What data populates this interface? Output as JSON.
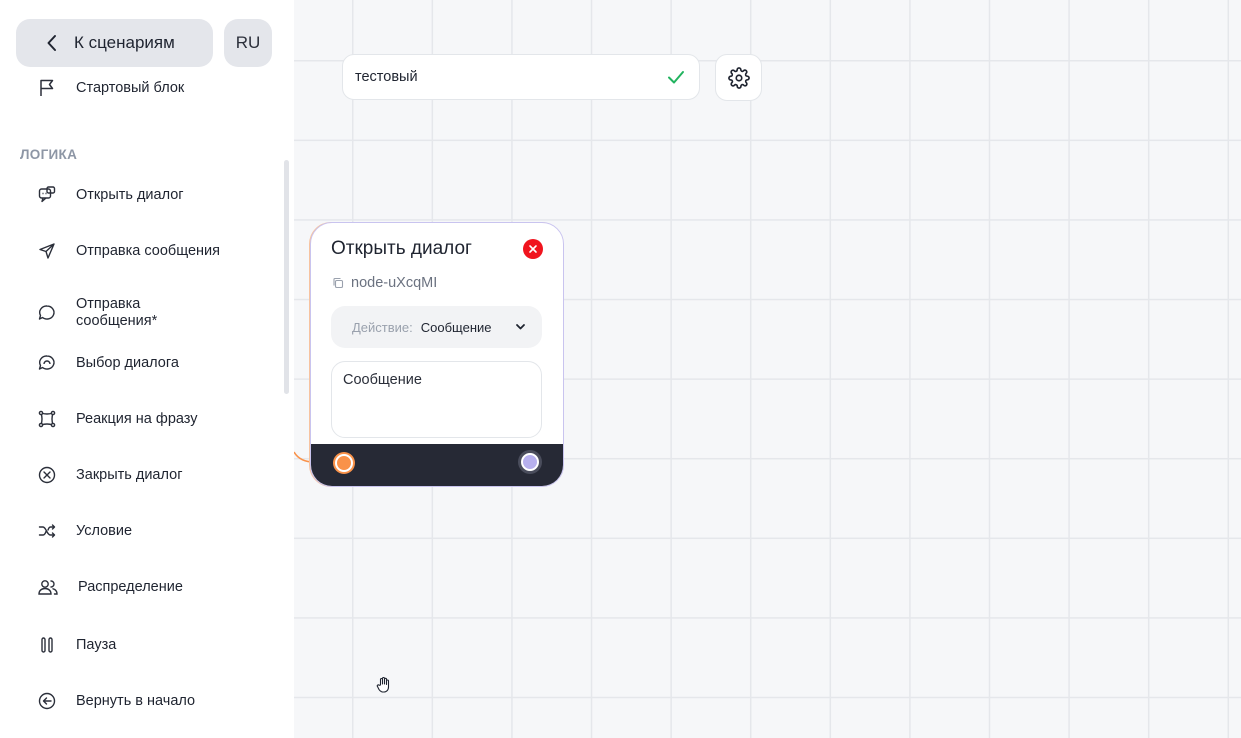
{
  "sidebar": {
    "back_label": "К сценариям",
    "lang_label": "RU",
    "start_item": {
      "label": "Стартовый блок",
      "icon": "flag-icon"
    },
    "section_logic": "ЛОГИКА",
    "items": [
      {
        "label": "Открыть диалог",
        "icon": "open-dialog-icon"
      },
      {
        "label": "Отправка сообщения",
        "icon": "send-icon"
      },
      {
        "label": "Отправка сообщения*",
        "icon": "message-bubble-icon"
      },
      {
        "label": "Выбор диалога",
        "icon": "dialog-select-icon"
      },
      {
        "label": "Реакция на фразу",
        "icon": "reaction-icon"
      },
      {
        "label": "Закрыть диалог",
        "icon": "close-circle-icon"
      },
      {
        "label": "Условие",
        "icon": "shuffle-icon"
      },
      {
        "label": "Распределение",
        "icon": "users-icon"
      },
      {
        "label": "Пауза",
        "icon": "pause-icon"
      },
      {
        "label": "Вернуть в начало",
        "icon": "return-icon"
      }
    ]
  },
  "toolbar": {
    "scenario_name": "тестовый",
    "confirm_icon": "check-icon",
    "settings_icon": "gear-icon"
  },
  "node": {
    "title": "Открыть диалог",
    "id_label": "node-uXcqMI",
    "action_label": "Действие:",
    "action_value": "Сообщение",
    "message_text": "Сообщение"
  },
  "colors": {
    "accent_orange": "#f9924a",
    "accent_violet": "#b7b0ee",
    "close_red": "#f0141e",
    "check_green": "#22b35f",
    "footer_dark": "#262935"
  }
}
